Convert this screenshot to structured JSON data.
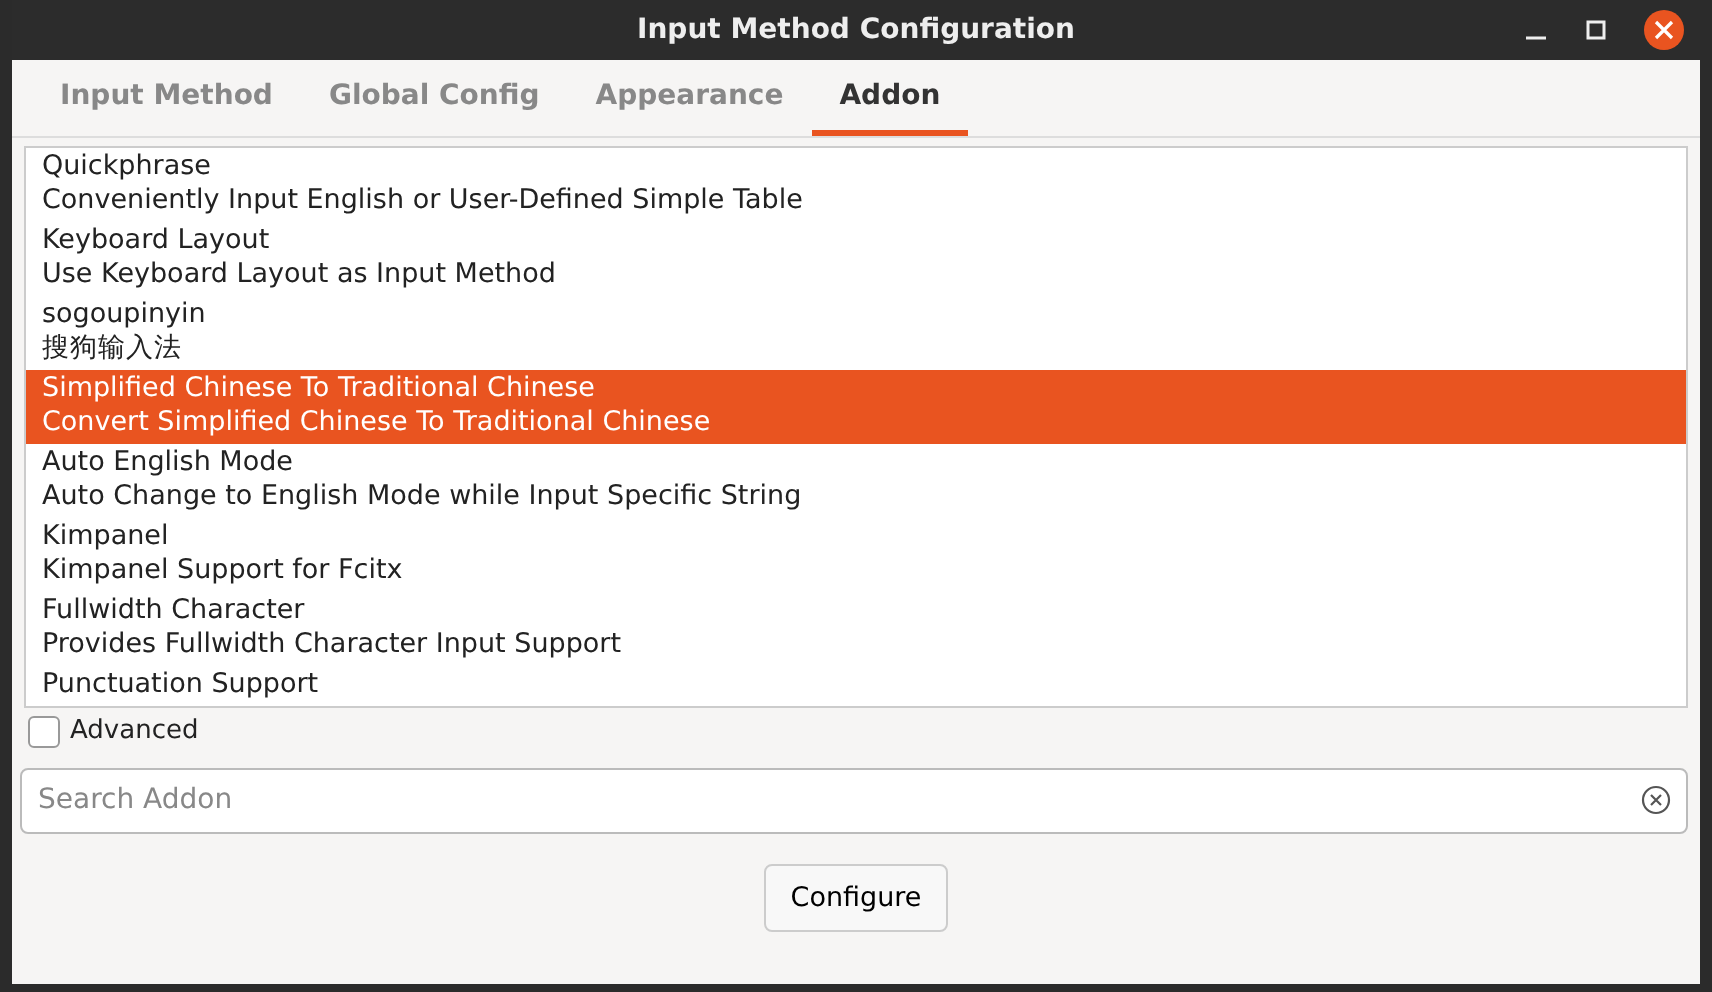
{
  "window": {
    "title": "Input Method Configuration"
  },
  "tabs": [
    {
      "label": "Input Method",
      "selected": false
    },
    {
      "label": "Global Config",
      "selected": false
    },
    {
      "label": "Appearance",
      "selected": false
    },
    {
      "label": "Addon",
      "selected": true
    }
  ],
  "addons": [
    {
      "name": "Quickphrase",
      "description": "Conveniently Input English or User-Defined Simple Table",
      "selected": false
    },
    {
      "name": "Keyboard Layout",
      "description": "Use Keyboard Layout as Input Method",
      "selected": false
    },
    {
      "name": "sogoupinyin",
      "description": "搜狗输入法",
      "selected": false
    },
    {
      "name": "Simplified Chinese To Traditional Chinese",
      "description": "Convert Simplified Chinese To Traditional Chinese",
      "selected": true
    },
    {
      "name": "Auto English Mode",
      "description": "Auto Change to English Mode while Input Specific String",
      "selected": false
    },
    {
      "name": "Kimpanel",
      "description": "Kimpanel Support for Fcitx",
      "selected": false
    },
    {
      "name": "Fullwidth Character",
      "description": "Provides Fullwidth Character Input Support",
      "selected": false
    },
    {
      "name": "Punctuation Support",
      "selected": false
    }
  ],
  "advanced": {
    "label": "Advanced",
    "checked": false
  },
  "search": {
    "placeholder": "Search Addon"
  },
  "buttons": [
    "Configure"
  ]
}
